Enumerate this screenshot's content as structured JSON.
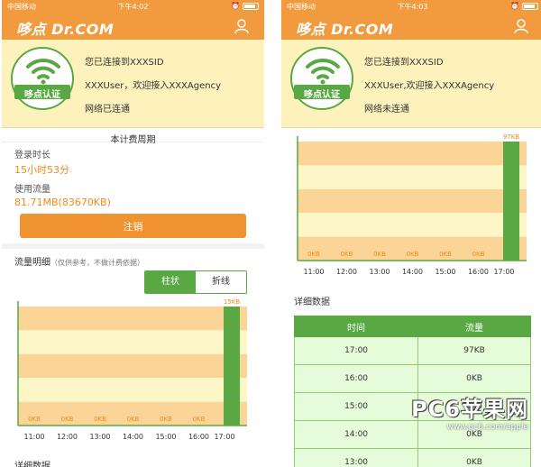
{
  "status_left": {
    "carrier": "中国移动",
    "time": "下午4:02"
  },
  "status_right": {
    "carrier": "中国移动",
    "time": "下午4:03"
  },
  "app": {
    "logo": "哆点 Dr.COM",
    "badge": "哆点认证"
  },
  "left": {
    "connected": "您已连接到XXXSID",
    "welcome": "XXXUser，欢迎接入XXXAgency",
    "network": "网络已连通",
    "period_title": "本计费周期",
    "login_time_label": "登录时长",
    "login_time_value": "15小时53分",
    "usage_label": "使用流量",
    "usage_value": "81.71MB(83670KB)",
    "logout": "注销",
    "flow_title": "流量明细",
    "flow_note": "（仅供参考，不做计费依据）",
    "toggle_bar": "柱状",
    "toggle_line": "折线",
    "detail_partial": "详细数据"
  },
  "right": {
    "connected": "您已连接到XXXSID",
    "welcome": "XXXUser,欢迎接入XXXAgency",
    "network": "网络未连通",
    "detail_title": "详细数据",
    "table": {
      "headers": [
        "时间",
        "流量"
      ],
      "rows": [
        [
          "17:00",
          "97KB"
        ],
        [
          "16:00",
          "0KB"
        ],
        [
          "15:00",
          "0KB"
        ],
        [
          "14:00",
          "0KB"
        ],
        [
          "13:00",
          "0KB"
        ]
      ]
    }
  },
  "chart_data": [
    {
      "type": "bar",
      "categories": [
        "11:00",
        "12:00",
        "13:00",
        "14:00",
        "15:00",
        "16:00",
        "17:00"
      ],
      "values": [
        0,
        0,
        0,
        0,
        0,
        0,
        15
      ],
      "labels": [
        "0KB",
        "0KB",
        "0KB",
        "0KB",
        "0KB",
        "0KB",
        "15KB"
      ],
      "ylim": [
        0,
        15
      ]
    },
    {
      "type": "bar",
      "categories": [
        "11:00",
        "12:00",
        "13:00",
        "14:00",
        "15:00",
        "16:00",
        "17:00"
      ],
      "values": [
        0,
        0,
        0,
        0,
        0,
        0,
        97
      ],
      "labels": [
        "0KB",
        "0KB",
        "0KB",
        "0KB",
        "0KB",
        "0KB",
        "97KB"
      ],
      "ylim": [
        0,
        97
      ]
    }
  ],
  "watermark": {
    "brand": "PC6苹果网",
    "url": "www.pc6.com/apple"
  },
  "colors": {
    "orange": "#f19a3e",
    "green": "#5aa843",
    "cream": "#fdf2bc"
  }
}
